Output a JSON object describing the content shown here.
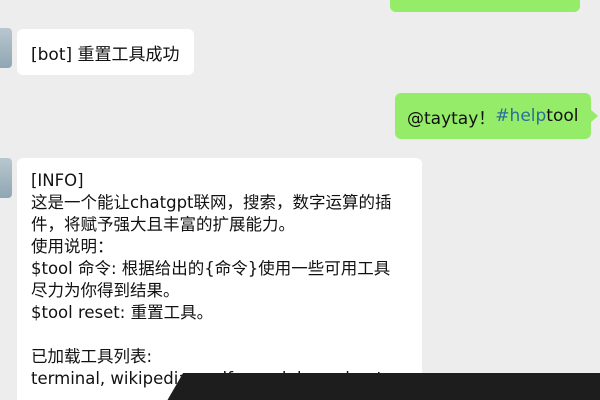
{
  "colors": {
    "background": "#ededed",
    "user_bubble": "#95ec69",
    "bot_bubble": "#ffffff",
    "hashtag": "#2a6f97",
    "overlay": "#1d1d1d"
  },
  "messages": {
    "bot_reset": "[bot] 重置工具成功",
    "user_command": {
      "mention": "@taytay！",
      "hashtag": "#help",
      "text": " tool"
    },
    "info": {
      "lines": [
        "[INFO]",
        "这是一个能让chatgpt联网，搜索，数字运算的插",
        "件，将赋予强大且丰富的扩展能力。",
        "使用说明：",
        "$tool 命令: 根据给出的{命令}使用一些可用工具",
        "尽力为你得到结果。",
        "$tool reset: 重置工具。",
        "",
        "已加载工具列表:",
        "terminal, wikipedia, wolfram-alpha, url-get,"
      ]
    }
  },
  "icons": {
    "avatar": "avatar-icon"
  }
}
